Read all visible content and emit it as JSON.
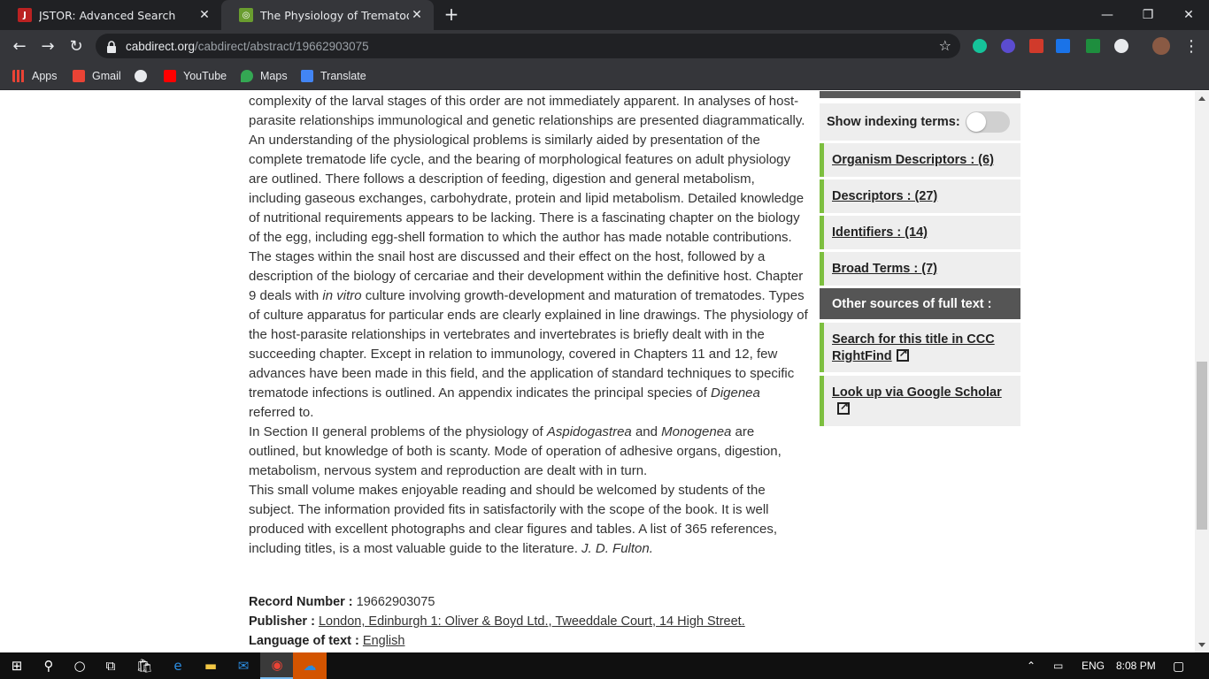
{
  "browser": {
    "tabs": [
      {
        "title": "JSTOR: Advanced Search",
        "active": false
      },
      {
        "title": "The Physiology of Trematodes.",
        "active": true
      }
    ],
    "url_host": "cabdirect.org",
    "url_path": "/cabdirect/abstract/19662903075",
    "bookmarks": [
      "Apps",
      "Gmail",
      "YouTube",
      "Maps",
      "Translate"
    ]
  },
  "abstract": {
    "p1_a": "complexity of the larval stages of this order are not immediately apparent. In analyses of host-parasite relationships immunological and genetic relationships are presented diagrammatically. An understanding of the physiological problems is similarly aided by presentation of the complete trematode life cycle, and the bearing of morphological features on adult physiology are outlined. There follows a description of feeding, digestion and general metabolism, including gaseous exchanges, carbohydrate, protein and lipid metabolism. Detailed knowledge of nutritional requirements appears to be lacking. There is a fascinating chapter on the biology of the egg, including egg-shell formation to which the author has made notable contributions. The stages within the snail host are discussed and their effect on the host, followed by a description of the biology of cercariae and their development within the definitive host. Chapter 9 deals with ",
    "p1_italic1": "in vitro",
    "p1_b": " culture involving growth-development and maturation of trematodes. Types of culture apparatus for particular ends are clearly explained in line drawings. The physiology of the host-parasite relationships in vertebrates and invertebrates is briefly dealt with in the succeeding chapter. Except in relation to immunology, covered in Chapters 11 and 12, few advances have been made in this field, and the application of standard techniques to specific trematode infections is outlined. An appendix indicates the principal species of ",
    "p1_italic2": "Digenea",
    "p1_c": " referred to.",
    "p2_a": "In Section II general problems of the physiology of ",
    "p2_italic1": "Aspidogastrea",
    "p2_b": " and ",
    "p2_italic2": "Monogenea",
    "p2_c": " are outlined, but knowledge of both is scanty. Mode of operation of adhesive organs, digestion, metabolism, nervous system and reproduction are dealt with in turn.",
    "p3_a": "This small volume makes enjoyable reading and should be welcomed by students of the subject. The information provided fits in satisfactorily with the scope of the book. It is well produced with excellent photographs and clear figures and tables. A list of 365 references, including titles, is a most valuable guide to the literature. ",
    "p3_italic": "J. D. Fulton."
  },
  "meta": {
    "record_label": "Record Number : ",
    "record_value": "19662903075",
    "publisher_label": "Publisher : ",
    "publisher_value": "London, Edinburgh 1: Oliver & Boyd Ltd., Tweeddale Court, 14 High Street.",
    "language_label": "Language of text : ",
    "language_value": "English"
  },
  "sidebar": {
    "show_indexing_label": "Show indexing terms:",
    "show_indexing_on": false,
    "facets": [
      "Organism Descriptors : (6)",
      "Descriptors : (27)",
      "Identifiers : (14)",
      "Broad Terms : (7)"
    ],
    "other_sources_title": "Other sources of full text :",
    "sources": [
      "Search for this title in CCC RightFind",
      "Look up via Google Scholar"
    ]
  },
  "taskbar": {
    "lang": "ENG",
    "time": "8:08 PM"
  },
  "colors": {
    "accent_green": "#7dbf3f",
    "sidebar_dark": "#555555"
  }
}
